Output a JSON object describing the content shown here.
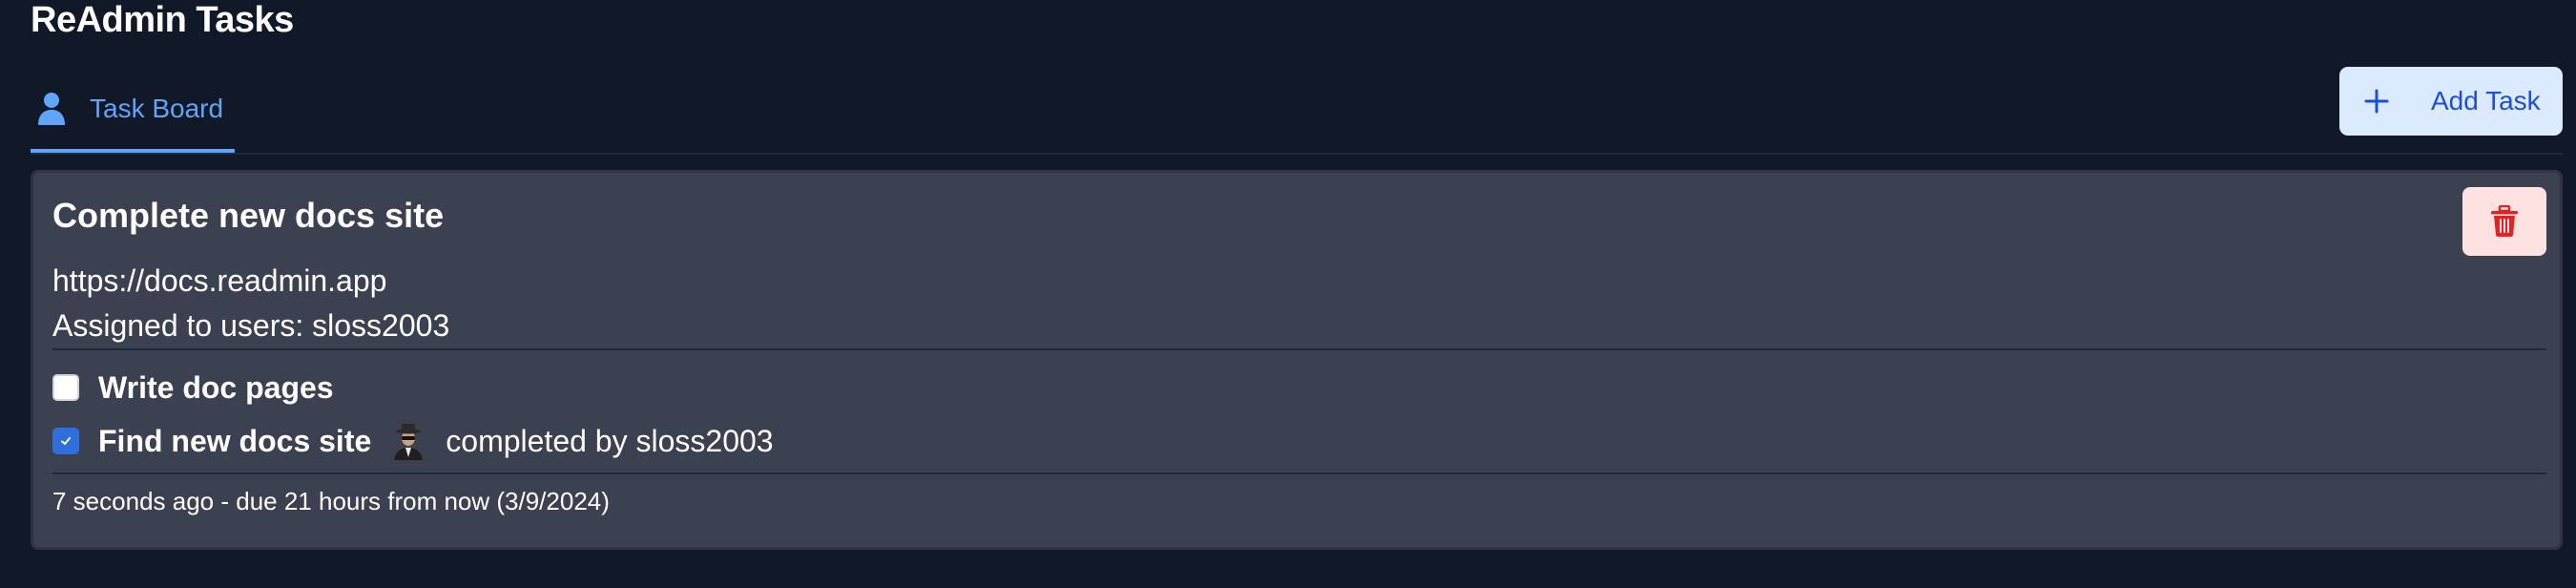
{
  "app": {
    "title": "ReAdmin Tasks"
  },
  "tabs": [
    {
      "label": "Task Board",
      "icon": "user-icon",
      "active": true
    }
  ],
  "toolbar": {
    "add_task_label": "Add Task",
    "add_task_icon": "plus-icon"
  },
  "task": {
    "title": "Complete new docs site",
    "url": "https://docs.readmin.app",
    "assigned": "Assigned to users: sloss2003",
    "delete_icon": "trash-icon",
    "subtasks": [
      {
        "label": "Write doc pages",
        "checked": false
      },
      {
        "label": "Find new docs site",
        "checked": true,
        "completed_by": "completed by sloss2003",
        "avatar_icon": "user-avatar"
      }
    ],
    "meta": "7 seconds ago - due 21 hours from now (3/9/2024)"
  },
  "colors": {
    "background": "#111827",
    "card": "#3b4150",
    "accent": "#60a5fa",
    "button_bg": "#dbeafe",
    "button_text": "#1d4ed8",
    "delete_bg": "#fee2e2",
    "delete_icon": "#dc2626",
    "checkbox_checked": "#2f6fdb"
  }
}
